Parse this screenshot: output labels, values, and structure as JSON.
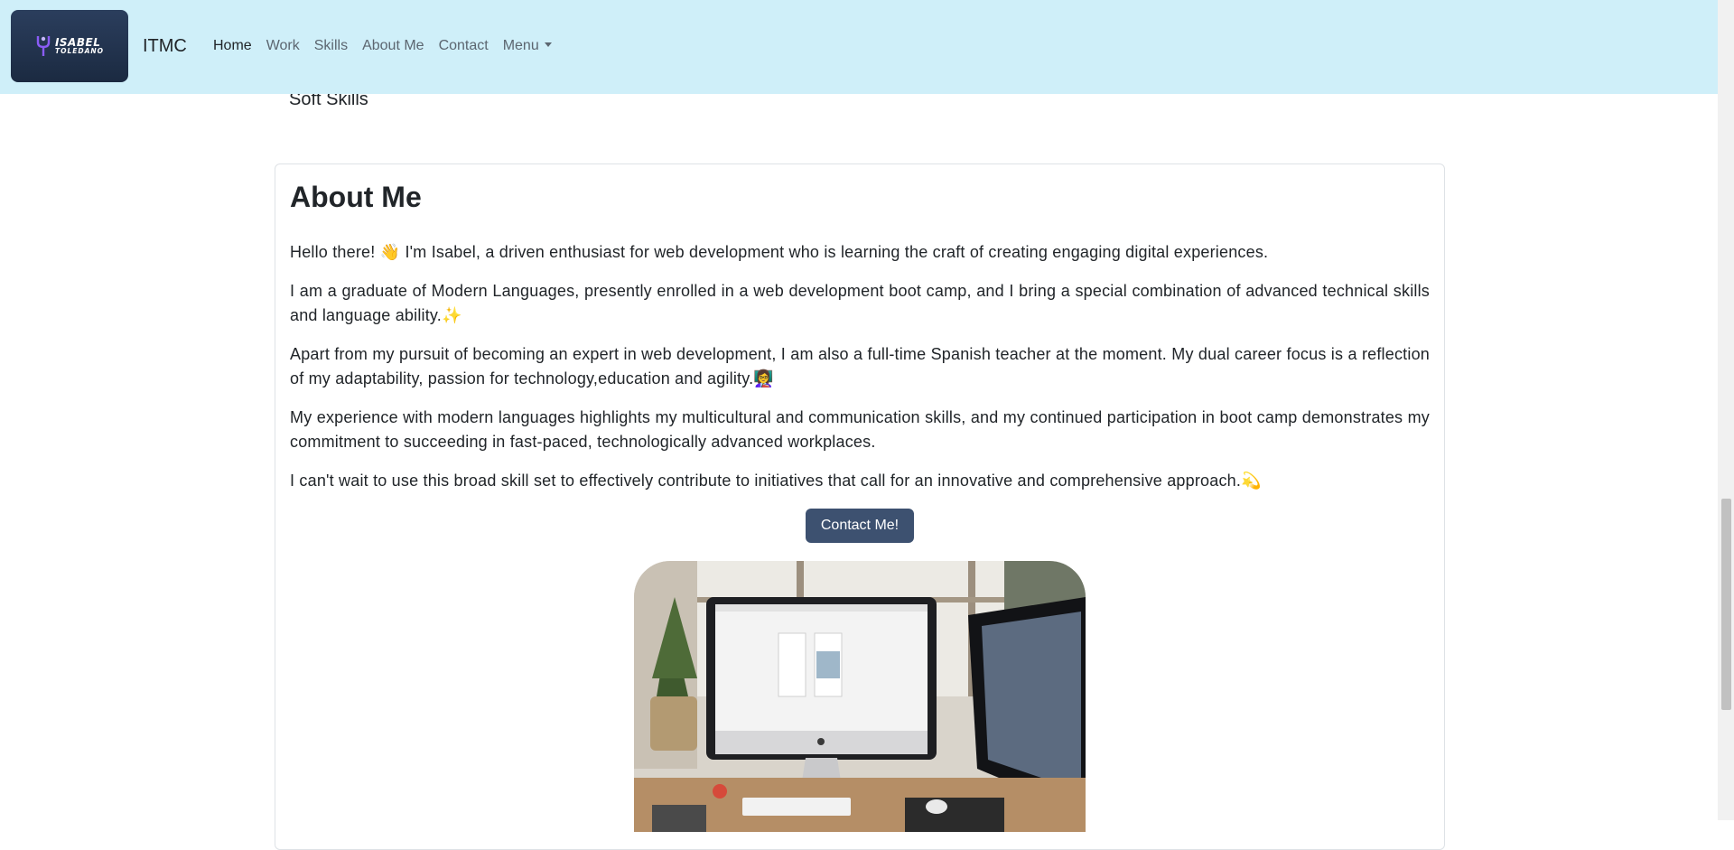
{
  "logo": {
    "line1": "ISABEL",
    "line2": "TOLEDANO"
  },
  "navbar": {
    "brand": "ITMC",
    "links": [
      {
        "label": "Home"
      },
      {
        "label": "Work"
      },
      {
        "label": "Skills"
      },
      {
        "label": "About Me"
      },
      {
        "label": "Contact"
      },
      {
        "label": "Menu"
      }
    ]
  },
  "skills_tail": "Soft Skills",
  "about": {
    "title": "About Me",
    "paragraphs": [
      "Hello there! 👋 I'm Isabel, a driven enthusiast for web development who is learning the craft of creating engaging digital experiences.",
      "I am a graduate of Modern Languages, presently enrolled in a web development boot camp, and I bring a special combination of advanced technical skills and language ability.✨",
      "Apart from my pursuit of becoming an expert in web development, I am also a full-time Spanish teacher at the moment. My dual career focus is a reflection of my adaptability, passion for technology,education and agility.👩‍🏫",
      "My experience with modern languages highlights my multicultural and communication skills, and my continued participation in boot camp demonstrates my commitment to succeeding in fast-paced, technologically advanced workplaces.",
      "I can't wait to use this broad skill set to effectively contribute to initiatives that call for an innovative and comprehensive approach.💫"
    ],
    "contact_button": "Contact Me!"
  },
  "colors": {
    "navbar_bg": "#cfeff9",
    "button_bg": "#3d5170",
    "logo_bg": "#1b2a41"
  }
}
